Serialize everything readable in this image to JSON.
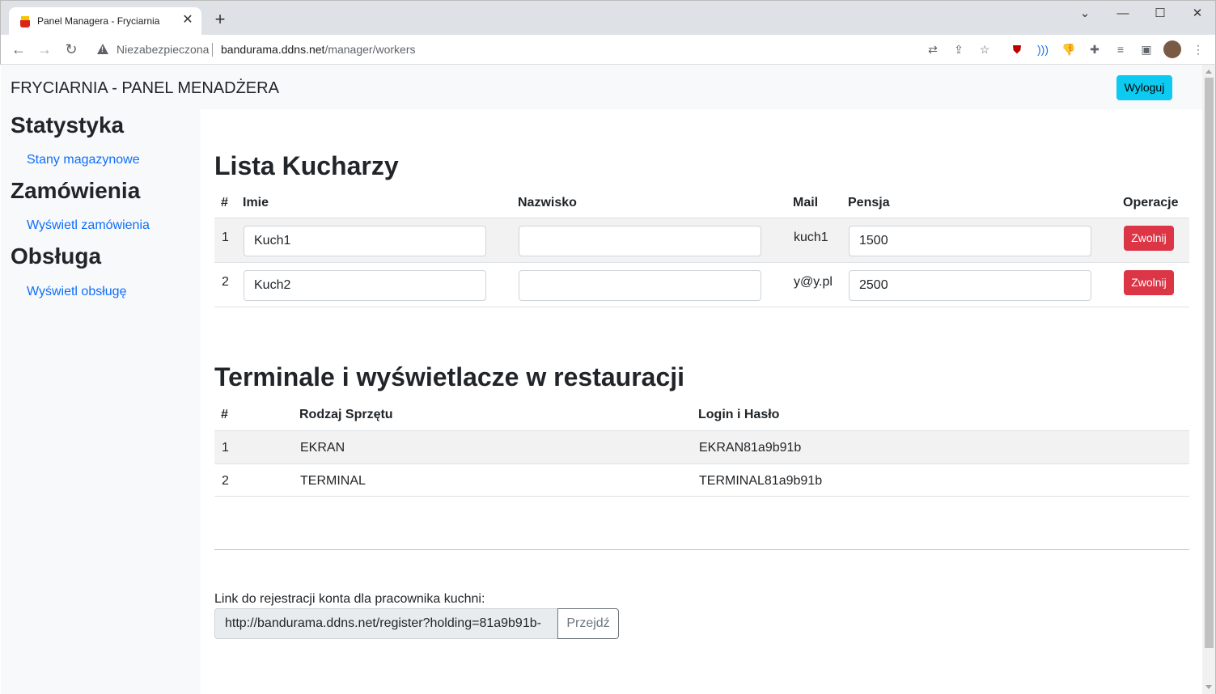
{
  "browser": {
    "tab_title": "Panel Managera - Fryciarnia",
    "security_label": "Niezabezpieczona",
    "url_host": "bandurama.ddns.net",
    "url_path": "/manager/workers"
  },
  "navbar": {
    "brand": "FRYCIARNIA - PANEL MENADŻERA",
    "logout_label": "Wyloguj"
  },
  "sidebar": {
    "sections": [
      {
        "heading": "Statystyka",
        "link": "Stany magazynowe"
      },
      {
        "heading": "Zamówienia",
        "link": "Wyświetl zamówienia"
      },
      {
        "heading": "Obsługa",
        "link": "Wyświetl obsługę"
      }
    ]
  },
  "cooks": {
    "title": "Lista Kucharzy",
    "headers": {
      "num": "#",
      "first": "Imie",
      "last": "Nazwisko",
      "mail": "Mail",
      "salary": "Pensja",
      "ops": "Operacje"
    },
    "rows": [
      {
        "num": "1",
        "first": "Kuch1",
        "last": "",
        "mail": "kuch1",
        "salary": "1500",
        "action": "Zwolnij"
      },
      {
        "num": "2",
        "first": "Kuch2",
        "last": "",
        "mail": "y@y.pl",
        "salary": "2500",
        "action": "Zwolnij"
      }
    ]
  },
  "terminals": {
    "title": "Terminale i wyświetlacze w restauracji",
    "headers": {
      "num": "#",
      "type": "Rodzaj Sprzętu",
      "login": "Login i Hasło"
    },
    "rows": [
      {
        "num": "1",
        "type": "EKRAN",
        "login": "EKRAN81a9b91b"
      },
      {
        "num": "2",
        "type": "TERMINAL",
        "login": "TERMINAL81a9b91b"
      }
    ]
  },
  "registration": {
    "label": "Link do rejestracji konta dla pracownika kuchni:",
    "link": "http://bandurama.ddns.net/register?holding=81a9b91b-",
    "go_label": "Przejdź"
  }
}
